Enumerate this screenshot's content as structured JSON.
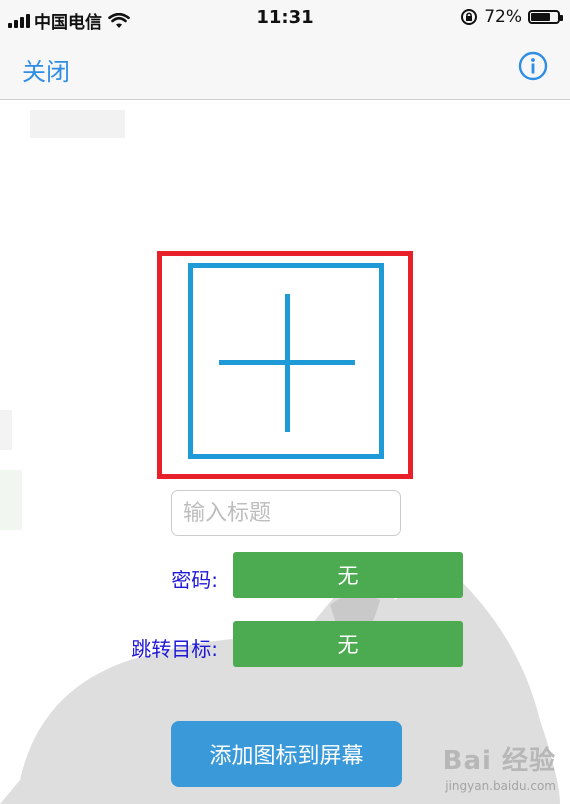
{
  "status_bar": {
    "carrier": "中国电信",
    "time": "11:31",
    "battery": "72%",
    "battery_level": 0.72
  },
  "nav": {
    "close_label": "关闭",
    "info_icon": "info-icon"
  },
  "icon_picker": {
    "icon": "plus-icon",
    "frame_color": "#1e9ad6",
    "highlight_color": "#e8202a"
  },
  "title_input": {
    "value": "",
    "placeholder": "输入标题"
  },
  "form": {
    "password_label": "密码:",
    "password_value": "无",
    "target_label": "跳转目标:",
    "target_value": "无"
  },
  "actions": {
    "add_label": "添加图标到屏幕"
  },
  "watermark": {
    "logo": "Bai 经验",
    "url": "jingyan.baidu.com"
  },
  "colors": {
    "accent": "#2f8de4",
    "green": "#4caa50",
    "button_blue": "#3a9ad9",
    "label_text": "#1f17d6"
  }
}
